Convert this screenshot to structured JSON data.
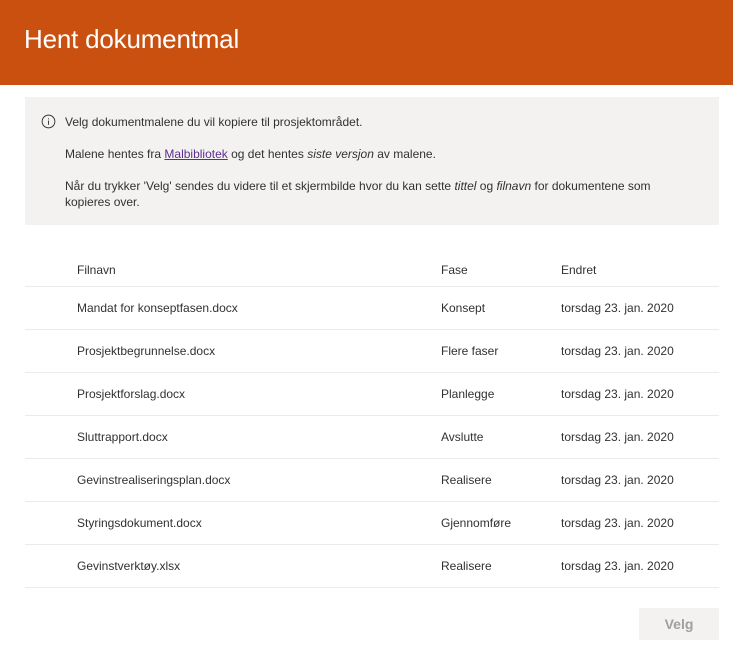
{
  "header": {
    "title": "Hent dokumentmal"
  },
  "info": {
    "line1": "Velg dokumentmalene du vil kopiere til prosjektområdet.",
    "line2_prefix": "Malene hentes fra ",
    "line2_link": "Malbibliotek",
    "line2_mid": " og det hentes ",
    "line2_em": "siste versjon",
    "line2_suffix": " av malene.",
    "line3_prefix": "Når du trykker 'Velg' sendes du videre til et skjermbilde hvor du kan sette ",
    "line3_em1": "tittel",
    "line3_mid": " og ",
    "line3_em2": "filnavn",
    "line3_suffix": " for dokumentene som",
    "line4": "kopieres over."
  },
  "table": {
    "columns": {
      "name": "Filnavn",
      "phase": "Fase",
      "changed": "Endret"
    },
    "rows": [
      {
        "name": "Mandat for konseptfasen.docx",
        "phase": "Konsept",
        "changed": "torsdag 23. jan. 2020"
      },
      {
        "name": "Prosjektbegrunnelse.docx",
        "phase": "Flere faser",
        "changed": "torsdag 23. jan. 2020"
      },
      {
        "name": "Prosjektforslag.docx",
        "phase": "Planlegge",
        "changed": "torsdag 23. jan. 2020"
      },
      {
        "name": "Sluttrapport.docx",
        "phase": "Avslutte",
        "changed": "torsdag 23. jan. 2020"
      },
      {
        "name": "Gevinstrealiseringsplan.docx",
        "phase": "Realisere",
        "changed": "torsdag 23. jan. 2020"
      },
      {
        "name": "Styringsdokument.docx",
        "phase": "Gjennomføre",
        "changed": "torsdag 23. jan. 2020"
      },
      {
        "name": "Gevinstverktøy.xlsx",
        "phase": "Realisere",
        "changed": "torsdag 23. jan. 2020"
      }
    ]
  },
  "footer": {
    "velg_label": "Velg"
  },
  "colors": {
    "header_bg": "#ca5010",
    "info_bg": "#f3f2f1",
    "link": "#5c2d91",
    "disabled_text": "#a19f9d"
  }
}
